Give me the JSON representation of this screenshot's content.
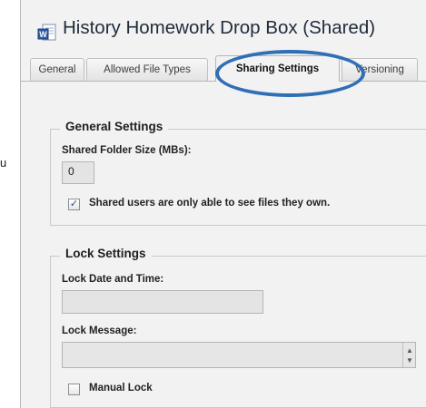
{
  "stray_char": "u",
  "window": {
    "title": "History Homework Drop Box (Shared)",
    "icon": "document-icon"
  },
  "tabs": [
    {
      "label": "General",
      "active": false
    },
    {
      "label": "Allowed File Types",
      "active": false
    },
    {
      "label": "Sharing Settings",
      "active": true
    },
    {
      "label": "Versioning",
      "active": false
    }
  ],
  "general_settings": {
    "title": "General Settings",
    "folder_size_label": "Shared Folder Size (MBs):",
    "folder_size_value": "0",
    "own_files_checkbox": {
      "label": "Shared users are only able to see files they own.",
      "checked": true
    }
  },
  "lock_settings": {
    "title": "Lock Settings",
    "date_label": "Lock Date and Time:",
    "date_value": "",
    "message_label": "Lock Message:",
    "message_value": "",
    "manual_lock_checkbox": {
      "label": "Manual Lock",
      "checked": false
    }
  },
  "colors": {
    "highlight": "#2f6fb6",
    "background": "#f2f2f2"
  }
}
